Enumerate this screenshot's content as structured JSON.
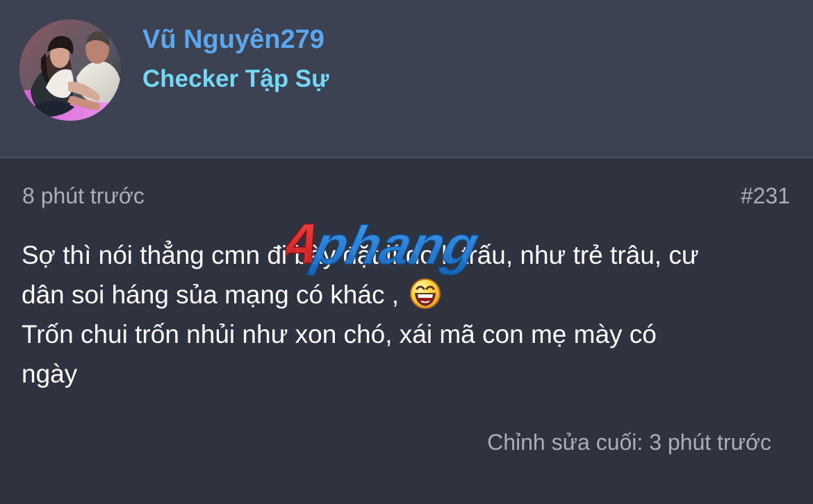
{
  "user": {
    "name": "Vũ Nguyên279",
    "role": "Checker Tập Sự"
  },
  "post": {
    "time": "8 phút trước",
    "number": "#231",
    "lines": [
      "Sợ thì nói thẳng cmn đi bày đặt lí do lí trấu, như trẻ trâu, cư",
      "dân soi háng sủa mạng có khác ,",
      "Trốn chui trốn nhủi như xon chó, xái mã con mẹ mày có",
      "ngày"
    ],
    "edit_note": "Chỉnh sửa cuối: 3 phút trước"
  },
  "watermark": {
    "text": "Aphang"
  },
  "colors": {
    "username": "#5aa6ef",
    "role": "#72d8f6",
    "header_background": "#3c4252",
    "post_background": "#2f3340",
    "muted_text": "#a9afba",
    "message_text": "#ffffff",
    "watermark_red": "#e52623",
    "watermark_blue": "#1f7fd8"
  },
  "icons": {
    "avatar": "user-avatar-photo",
    "emoji": "laughing-face-emoji"
  }
}
